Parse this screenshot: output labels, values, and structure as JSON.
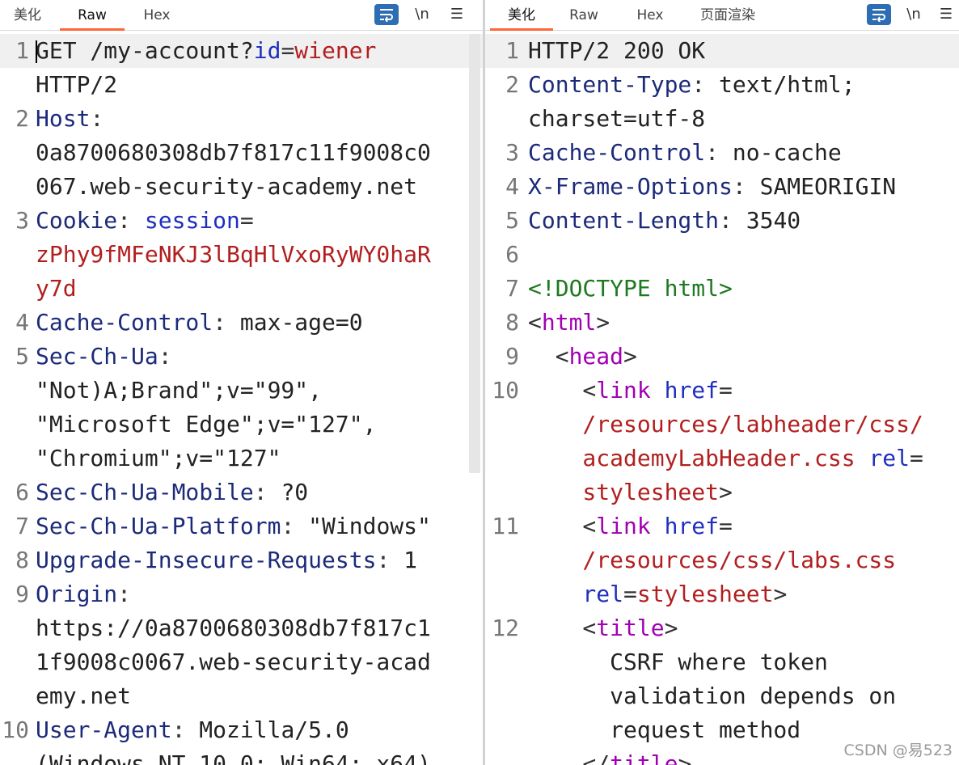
{
  "request_pane": {
    "tabs": [
      "美化",
      "Raw",
      "Hex"
    ],
    "active_tab": "Raw",
    "tools": {
      "wrap_icon": "wrap-lines-icon",
      "newline_label": "\\n",
      "menu_label": "☰"
    },
    "lines": [
      {
        "n": "1",
        "segs": [
          [
            "t-text",
            "GET /my-account?"
          ],
          [
            "t-param",
            "id"
          ],
          [
            "t-punct",
            "="
          ],
          [
            "t-val",
            "wiener"
          ]
        ]
      },
      {
        "n": "",
        "segs": [
          [
            "t-text",
            "HTTP/2"
          ]
        ]
      },
      {
        "n": "2",
        "segs": [
          [
            "t-key",
            "Host"
          ],
          [
            "t-punct",
            ":"
          ]
        ]
      },
      {
        "n": "",
        "segs": [
          [
            "t-text",
            "0a8700680308db7f817c11f9008c0"
          ]
        ]
      },
      {
        "n": "",
        "segs": [
          [
            "t-text",
            "067.web-security-academy.net"
          ]
        ]
      },
      {
        "n": "3",
        "segs": [
          [
            "t-key",
            "Cookie"
          ],
          [
            "t-punct",
            ": "
          ],
          [
            "t-param",
            "session"
          ],
          [
            "t-punct",
            "="
          ]
        ]
      },
      {
        "n": "",
        "segs": [
          [
            "t-val",
            "zPhy9fMFeNKJ3lBqHlVxoRyWY0haR"
          ]
        ]
      },
      {
        "n": "",
        "segs": [
          [
            "t-val",
            "y7d"
          ]
        ]
      },
      {
        "n": "4",
        "segs": [
          [
            "t-key",
            "Cache-Control"
          ],
          [
            "t-punct",
            ": "
          ],
          [
            "t-text",
            "max-age=0"
          ]
        ]
      },
      {
        "n": "5",
        "segs": [
          [
            "t-key",
            "Sec-Ch-Ua"
          ],
          [
            "t-punct",
            ":"
          ]
        ]
      },
      {
        "n": "",
        "segs": [
          [
            "t-text",
            "\"Not)A;Brand\";v=\"99\","
          ]
        ]
      },
      {
        "n": "",
        "segs": [
          [
            "t-text",
            "\"Microsoft Edge\";v=\"127\","
          ]
        ]
      },
      {
        "n": "",
        "segs": [
          [
            "t-text",
            "\"Chromium\";v=\"127\""
          ]
        ]
      },
      {
        "n": "6",
        "segs": [
          [
            "t-key",
            "Sec-Ch-Ua-Mobile"
          ],
          [
            "t-punct",
            ": "
          ],
          [
            "t-text",
            "?0"
          ]
        ]
      },
      {
        "n": "7",
        "segs": [
          [
            "t-key",
            "Sec-Ch-Ua-Platform"
          ],
          [
            "t-punct",
            ": "
          ],
          [
            "t-text",
            "\"Windows\""
          ]
        ]
      },
      {
        "n": "8",
        "segs": [
          [
            "t-key",
            "Upgrade-Insecure-Requests"
          ],
          [
            "t-punct",
            ": "
          ],
          [
            "t-text",
            "1"
          ]
        ]
      },
      {
        "n": "9",
        "segs": [
          [
            "t-key",
            "Origin"
          ],
          [
            "t-punct",
            ":"
          ]
        ]
      },
      {
        "n": "",
        "segs": [
          [
            "t-text",
            "https://0a8700680308db7f817c1"
          ]
        ]
      },
      {
        "n": "",
        "segs": [
          [
            "t-text",
            "1f9008c0067.web-security-acad"
          ]
        ]
      },
      {
        "n": "",
        "segs": [
          [
            "t-text",
            "emy.net"
          ]
        ]
      },
      {
        "n": "10",
        "segs": [
          [
            "t-key",
            "User-Agent"
          ],
          [
            "t-punct",
            ": "
          ],
          [
            "t-text",
            "Mozilla/5.0"
          ]
        ]
      },
      {
        "n": "",
        "segs": [
          [
            "t-text",
            "(Windows NT 10.0; Win64; x64)"
          ]
        ]
      }
    ]
  },
  "response_pane": {
    "tabs": [
      "美化",
      "Raw",
      "Hex",
      "页面渲染"
    ],
    "active_tab": "美化",
    "tools": {
      "wrap_icon": "wrap-lines-icon",
      "newline_label": "\\n",
      "menu_label": "☰"
    },
    "lines": [
      {
        "n": "1",
        "segs": [
          [
            "t-text",
            "HTTP/2 200 OK"
          ]
        ]
      },
      {
        "n": "2",
        "segs": [
          [
            "t-key",
            "Content-Type"
          ],
          [
            "t-punct",
            ": "
          ],
          [
            "t-text",
            "text/html;"
          ]
        ]
      },
      {
        "n": "",
        "segs": [
          [
            "t-text",
            "charset=utf-8"
          ]
        ]
      },
      {
        "n": "3",
        "segs": [
          [
            "t-key",
            "Cache-Control"
          ],
          [
            "t-punct",
            ": "
          ],
          [
            "t-text",
            "no-cache"
          ]
        ]
      },
      {
        "n": "4",
        "segs": [
          [
            "t-key",
            "X-Frame-Options"
          ],
          [
            "t-punct",
            ": "
          ],
          [
            "t-text",
            "SAMEORIGIN"
          ]
        ]
      },
      {
        "n": "5",
        "segs": [
          [
            "t-key",
            "Content-Length"
          ],
          [
            "t-punct",
            ": "
          ],
          [
            "t-text",
            "3540"
          ]
        ]
      },
      {
        "n": "6",
        "segs": []
      },
      {
        "n": "7",
        "segs": [
          [
            "t-doctype",
            "<!DOCTYPE html>"
          ]
        ]
      },
      {
        "n": "8",
        "segs": [
          [
            "t-punct",
            "<"
          ],
          [
            "t-tag",
            "html"
          ],
          [
            "t-punct",
            ">"
          ]
        ]
      },
      {
        "n": "9",
        "segs": [
          [
            "t-punct",
            "  <"
          ],
          [
            "t-tag",
            "head"
          ],
          [
            "t-punct",
            ">"
          ]
        ]
      },
      {
        "n": "10",
        "segs": [
          [
            "t-punct",
            "    <"
          ],
          [
            "t-tag",
            "link "
          ],
          [
            "t-attr",
            "href"
          ],
          [
            "t-punct",
            "="
          ]
        ]
      },
      {
        "n": "",
        "segs": [
          [
            "t-val",
            "    /resources/labheader/css/"
          ]
        ]
      },
      {
        "n": "",
        "segs": [
          [
            "t-val",
            "    academyLabHeader.css "
          ],
          [
            "t-attr",
            "rel"
          ],
          [
            "t-punct",
            "="
          ]
        ]
      },
      {
        "n": "",
        "segs": [
          [
            "t-val",
            "    stylesheet"
          ],
          [
            "t-punct",
            ">"
          ]
        ]
      },
      {
        "n": "11",
        "segs": [
          [
            "t-punct",
            "    <"
          ],
          [
            "t-tag",
            "link "
          ],
          [
            "t-attr",
            "href"
          ],
          [
            "t-punct",
            "="
          ]
        ]
      },
      {
        "n": "",
        "segs": [
          [
            "t-val",
            "    /resources/css/labs.css"
          ]
        ]
      },
      {
        "n": "",
        "segs": [
          [
            "t-attr",
            "    rel"
          ],
          [
            "t-punct",
            "="
          ],
          [
            "t-val",
            "stylesheet"
          ],
          [
            "t-punct",
            ">"
          ]
        ]
      },
      {
        "n": "12",
        "segs": [
          [
            "t-punct",
            "    <"
          ],
          [
            "t-tag",
            "title"
          ],
          [
            "t-punct",
            ">"
          ]
        ]
      },
      {
        "n": "",
        "segs": [
          [
            "t-text",
            "      CSRF where token"
          ]
        ]
      },
      {
        "n": "",
        "segs": [
          [
            "t-text",
            "      validation depends on"
          ]
        ]
      },
      {
        "n": "",
        "segs": [
          [
            "t-text",
            "      request method"
          ]
        ]
      },
      {
        "n": "",
        "segs": [
          [
            "t-punct",
            "    </"
          ],
          [
            "t-tag",
            "title"
          ],
          [
            "t-punct",
            ">"
          ]
        ]
      }
    ]
  },
  "watermark": "CSDN @易523"
}
